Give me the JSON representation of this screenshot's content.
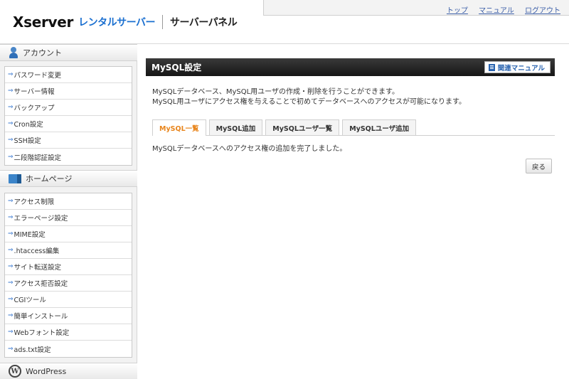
{
  "header": {
    "logo_main": "Xserver",
    "logo_sub": "レンタルサーバー",
    "logo_panel": "サーバーパネル",
    "links": [
      "トップ",
      "マニュアル",
      "ログアウト"
    ]
  },
  "sidebar": {
    "sections": [
      {
        "title": "アカウント",
        "icon": "account-icon",
        "items": [
          "パスワード変更",
          "サーバー情報",
          "バックアップ",
          "Cron設定",
          "SSH設定",
          "二段階認証設定"
        ]
      },
      {
        "title": "ホームページ",
        "icon": "homepage-icon",
        "items": [
          "アクセス制限",
          "エラーページ設定",
          "MIME設定",
          ".htaccess編集",
          "サイト転送設定",
          "アクセス拒否設定",
          "CGIツール",
          "簡単インストール",
          "Webフォント設定",
          "ads.txt設定"
        ]
      },
      {
        "title": "WordPress",
        "icon": "wordpress-icon",
        "items": []
      }
    ]
  },
  "main": {
    "title": "MySQL設定",
    "manual_button": "関連マニュアル",
    "description": [
      "MySQLデータベース、MySQL用ユーザの作成・削除を行うことができます。",
      "MySQL用ユーザにアクセス権を与えることで初めてデータベースへのアクセスが可能になります。"
    ],
    "tabs": [
      "MySQL一覧",
      "MySQL追加",
      "MySQLユーザ一覧",
      "MySQLユーザ追加"
    ],
    "active_tab": 0,
    "message": "MySQLデータベースへのアクセス権の追加を完了しました。",
    "back_button": "戻る"
  },
  "colors": {
    "link": "#3c5fa8",
    "brand_blue": "#1a6fd0",
    "active_tab": "#e8841a",
    "title_bar": "#1f1f1f"
  }
}
